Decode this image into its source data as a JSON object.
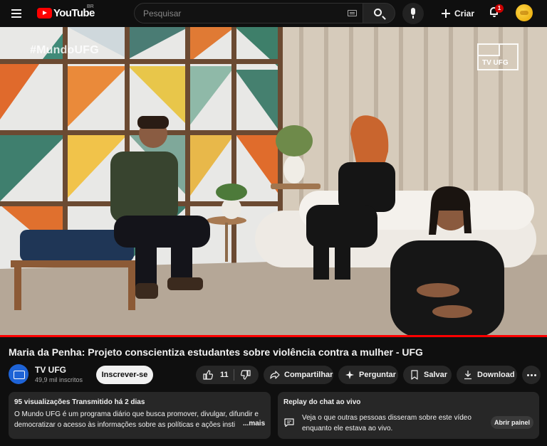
{
  "header": {
    "logo_text": "YouTube",
    "region": "BR",
    "search_placeholder": "Pesquisar",
    "create_label": "Criar",
    "notification_count": "1"
  },
  "player": {
    "hashtag_overlay": "#MundoUFG",
    "channel_bug": "TV UFG",
    "progress_fraction": 1.0,
    "progress_color": "#ff0000"
  },
  "video": {
    "title": "Maria da Penha: Projeto conscientiza estudantes sobre violência contra a mulher - UFG",
    "channel_name": "TV UFG",
    "subscribers": "49,9 mil inscritos",
    "subscribe_label": "Inscrever-se",
    "like_count": "11",
    "actions": {
      "share": "Compartilhar",
      "ask": "Perguntar",
      "save": "Salvar",
      "download": "Download"
    }
  },
  "description": {
    "meta": "95 visualizações  Transmitido há 2 dias",
    "text": "O Mundo UFG é um programa diário que busca promover, divulgar, difundir e democratizar o acesso às informações sobre as políticas e ações insti",
    "more_label": "...mais"
  },
  "chat_replay": {
    "title": "Replay do chat ao vivo",
    "text": "Veja o que outras pessoas disseram sobre este vídeo enquanto ele estava ao vivo.",
    "open_label": "Abrir painel"
  },
  "colors": {
    "background": "#0f0f0f",
    "surface": "#272727",
    "brand_red": "#ff0000",
    "channel_avatar": "#1e63d6"
  },
  "icons": [
    "menu-icon",
    "youtube-logo-icon",
    "keyboard-icon",
    "search-icon",
    "mic-icon",
    "plus-icon",
    "bell-icon",
    "thumbs-up-icon",
    "thumbs-down-icon",
    "share-icon",
    "sparkle-icon",
    "bookmark-icon",
    "download-icon",
    "more-icon",
    "chat-icon"
  ]
}
